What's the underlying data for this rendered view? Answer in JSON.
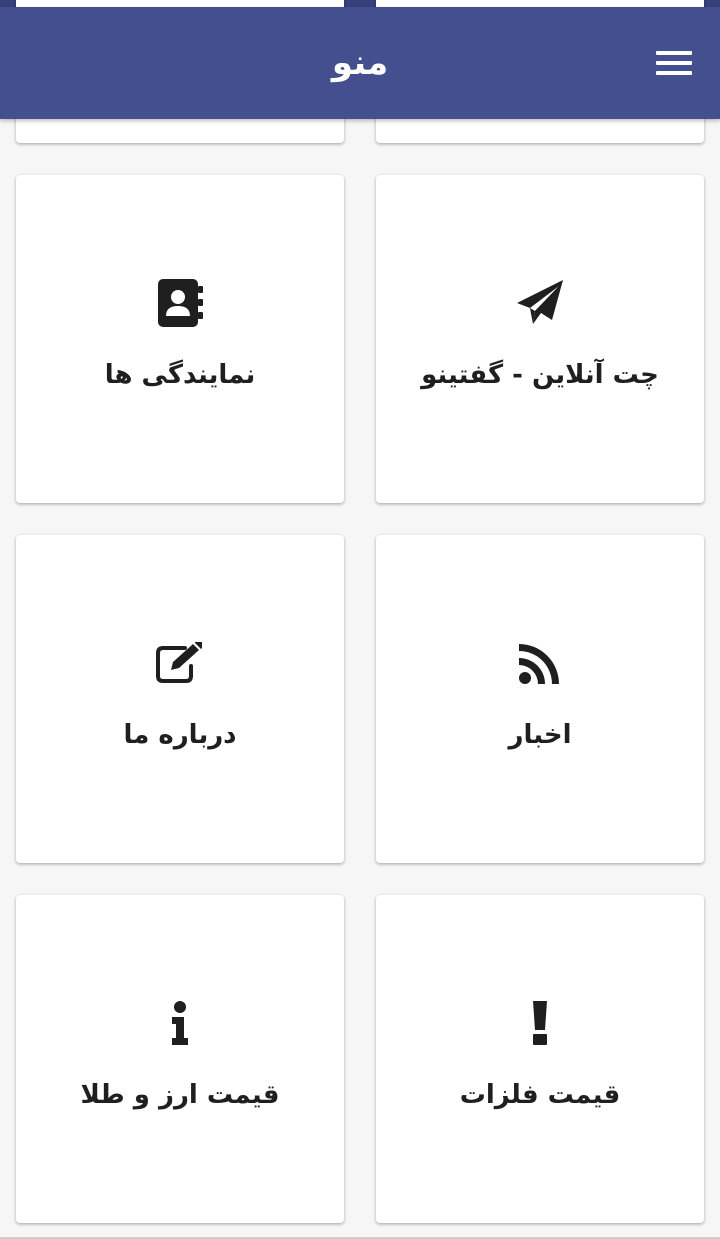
{
  "header": {
    "title": "منو",
    "menu_icon": "hamburger-menu-icon",
    "background": "#434f8e",
    "status_bar_color": "#36417a"
  },
  "cards": [
    {
      "label": "",
      "icon": "",
      "position": "partially-hidden-top-right"
    },
    {
      "label": "",
      "icon": "",
      "position": "partially-hidden-top-left"
    },
    {
      "label": "چت آنلاین - گفتینو",
      "icon": "paper-plane-icon"
    },
    {
      "label": "نمایندگی ها",
      "icon": "address-book-icon"
    },
    {
      "label": "اخبار",
      "icon": "rss-icon"
    },
    {
      "label": "درباره ما",
      "icon": "edit-icon"
    },
    {
      "label": "قیمت فلزات",
      "icon": "exclamation-icon"
    },
    {
      "label": "قیمت ارز و طلا",
      "icon": "info-icon"
    }
  ],
  "colors": {
    "card_text": "#1f1f1f",
    "icon": "#1f1f1f",
    "background": "#f6f6f6"
  }
}
